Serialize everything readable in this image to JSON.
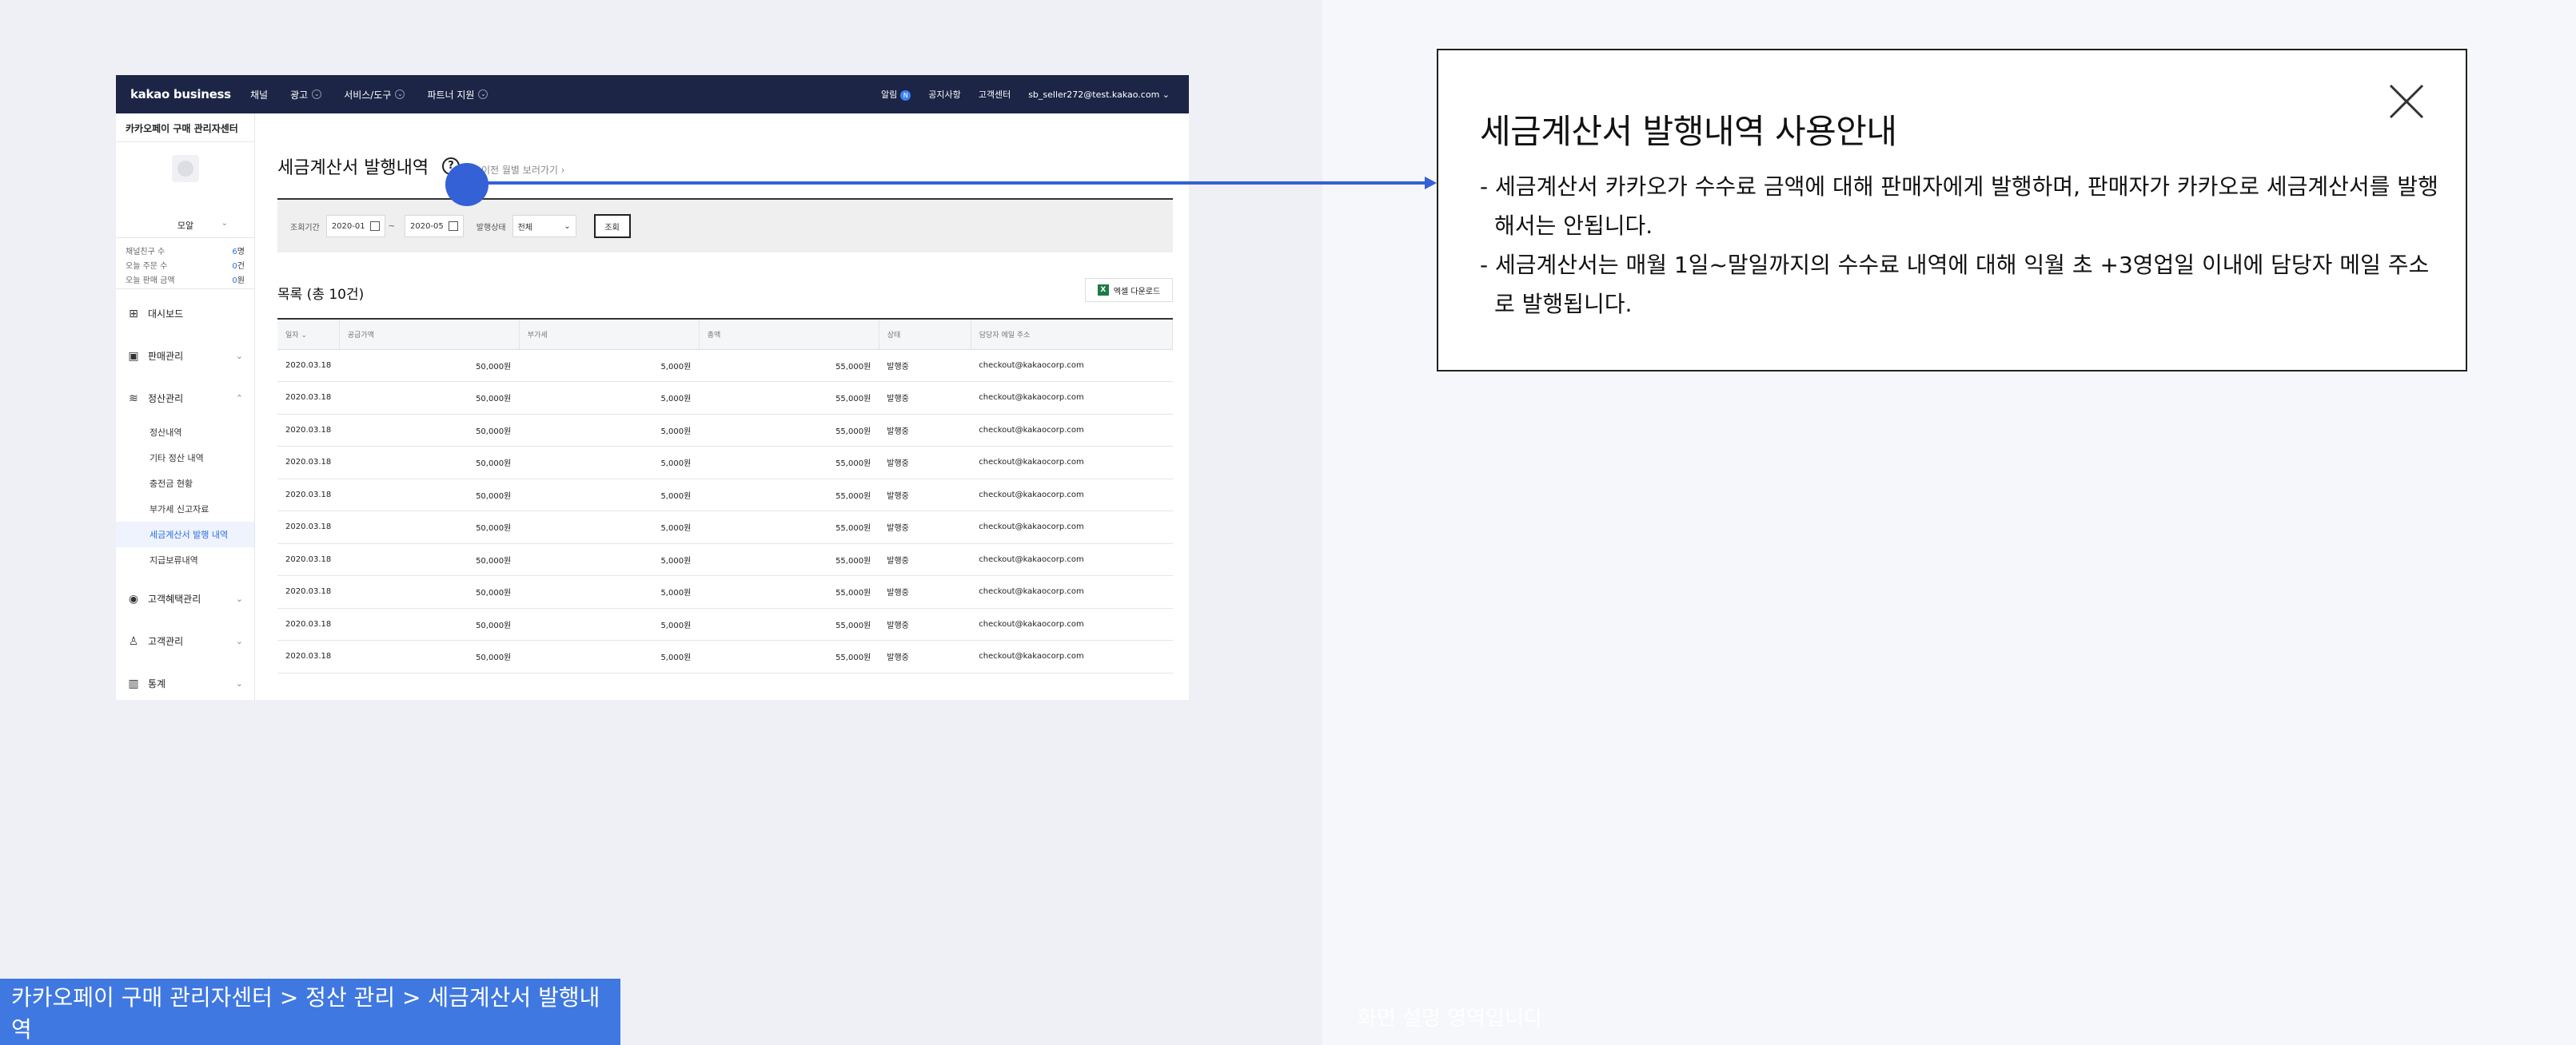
{
  "gnb": {
    "logo": "kakao business",
    "nav": [
      "채널",
      "광고",
      "서비스/도구",
      "파트너 지원"
    ],
    "right": {
      "alarm": "알림",
      "alarm_count": "N",
      "notice": "공지사항",
      "support": "고객센터",
      "account": "sb_seller272@test.kakao.com"
    }
  },
  "sidebar": {
    "title": "카카오페이 구매 관리자센터",
    "profile_name": "모알",
    "stats": [
      {
        "label": "채널친구 수",
        "value": "6",
        "unit": "명"
      },
      {
        "label": "오늘 주문 수",
        "value": "0",
        "unit": "건"
      },
      {
        "label": "오늘 판매 금액",
        "value": "0",
        "unit": "원"
      }
    ],
    "menu": {
      "dashboard": "대시보드",
      "sales": "판매관리",
      "settlement": "정산관리",
      "settlement_sub": [
        "정산내역",
        "기타 정산 내역",
        "충전금 현황",
        "부가세 신고자료",
        "세금계산서 발행 내역",
        "지급보류내역"
      ],
      "benefit": "고객혜택관리",
      "customer": "고객관리",
      "stats": "통계"
    }
  },
  "main": {
    "title": "세금계산서 발행내역",
    "help": "?",
    "prev_link": "이전 월별 보러가기",
    "filter": {
      "period_label": "조회기간",
      "from": "2020-01",
      "to": "2020-05",
      "tilde": "~",
      "status_label": "발행상태",
      "status_value": "전체",
      "search_button": "조회"
    },
    "list_title": "목록 (총 10건)",
    "excel_button": "엑셀 다운로드",
    "columns": [
      "일자",
      "공급가액",
      "부가세",
      "총액",
      "상태",
      "담당자 메일 주소"
    ],
    "rows": [
      [
        "2020.03.18",
        "50,000원",
        "5,000원",
        "55,000원",
        "발행중",
        "checkout@kakaocorp.com"
      ],
      [
        "2020.03.18",
        "50,000원",
        "5,000원",
        "55,000원",
        "발행중",
        "checkout@kakaocorp.com"
      ],
      [
        "2020.03.18",
        "50,000원",
        "5,000원",
        "55,000원",
        "발행중",
        "checkout@kakaocorp.com"
      ],
      [
        "2020.03.18",
        "50,000원",
        "5,000원",
        "55,000원",
        "발행중",
        "checkout@kakaocorp.com"
      ],
      [
        "2020.03.18",
        "50,000원",
        "5,000원",
        "55,000원",
        "발행중",
        "checkout@kakaocorp.com"
      ],
      [
        "2020.03.18",
        "50,000원",
        "5,000원",
        "55,000원",
        "발행중",
        "checkout@kakaocorp.com"
      ],
      [
        "2020.03.18",
        "50,000원",
        "5,000원",
        "55,000원",
        "발행중",
        "checkout@kakaocorp.com"
      ],
      [
        "2020.03.18",
        "50,000원",
        "5,000원",
        "55,000원",
        "발행중",
        "checkout@kakaocorp.com"
      ],
      [
        "2020.03.18",
        "50,000원",
        "5,000원",
        "55,000원",
        "발행중",
        "checkout@kakaocorp.com"
      ],
      [
        "2020.03.18",
        "50,000원",
        "5,000원",
        "55,000원",
        "발행중",
        "checkout@kakaocorp.com"
      ]
    ]
  },
  "info": {
    "title": "세금계산서 발행내역 사용안내",
    "lines": [
      "- 세금계산서 카카오가 수수료 금액에 대해 판매자에게 발행하며, 판매자가 카카오로 세금계산서를 발행해서는 안됩니다.",
      "- 세금계산서는 매월 1일~말일까지의 수수료 내역에 대해 익월 초 +3영업일 이내에 담당자 메일 주소로 발행됩니다."
    ]
  },
  "banner": {
    "breadcrumb": "카카오페이 구매 관리자센터 > 정산 관리 > 세금계산서 발행내역",
    "ghost": "화면 설명 영역입니다"
  },
  "colors": {
    "gnb": "#1c2545",
    "accent": "#3461d6",
    "banner": "#3f78e0"
  },
  "icons": [
    "chevron-down-icon",
    "calendar-icon",
    "excel-icon",
    "help-icon",
    "close-icon",
    "dashboard-icon",
    "sales-icon",
    "settlement-icon",
    "benefit-icon",
    "customer-icon",
    "stats-icon"
  ]
}
